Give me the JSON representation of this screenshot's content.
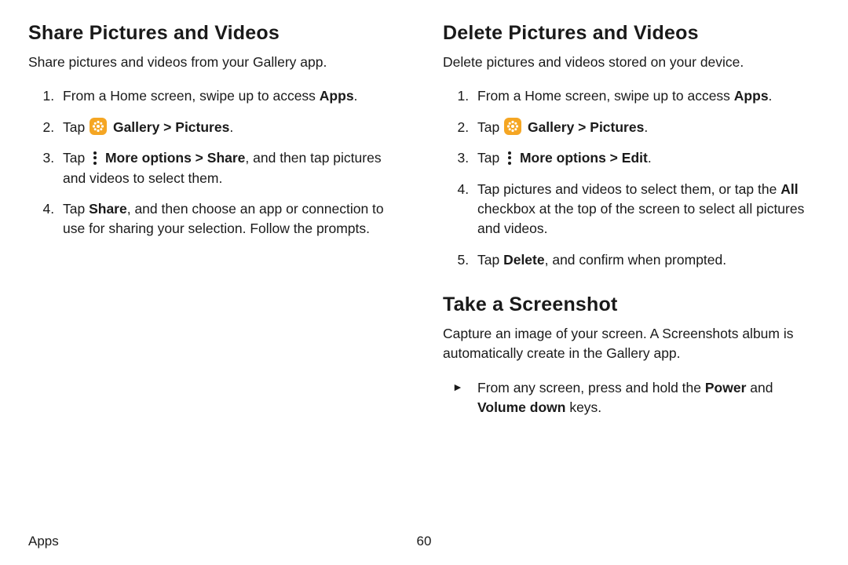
{
  "footer": {
    "section": "Apps",
    "page": "60"
  },
  "left": {
    "share": {
      "title": "Share Pictures and Videos",
      "intro": "Share pictures and videos from your Gallery app.",
      "step1_pre": "From a Home screen, swipe up to access ",
      "step1_bold": "Apps",
      "step1_post": ".",
      "step2_tap": "Tap ",
      "step2_gallery": "Gallery",
      "step2_gt": " > ",
      "step2_pictures": "Pictures",
      "step2_post": ".",
      "step3_tap": "Tap ",
      "step3_more": "More options",
      "step3_gt": " > ",
      "step3_share": "Share",
      "step3_post": ", and then tap pictures and videos to select them.",
      "step4_pre": "Tap ",
      "step4_share": "Share",
      "step4_post": ", and then choose an app or connection to use for sharing your selection. Follow the prompts."
    }
  },
  "right": {
    "del": {
      "title": "Delete Pictures and Videos",
      "intro": "Delete pictures and videos stored on your device.",
      "step1_pre": "From a Home screen, swipe up to access ",
      "step1_bold": "Apps",
      "step1_post": ".",
      "step2_tap": "Tap ",
      "step2_gallery": "Gallery",
      "step2_gt": " > ",
      "step2_pictures": "Pictures",
      "step2_post": ".",
      "step3_tap": "Tap ",
      "step3_more": "More options",
      "step3_gt": " > ",
      "step3_edit": "Edit",
      "step3_post": ".",
      "step4_pre": "Tap pictures and videos to select them, or tap the ",
      "step4_all": "All",
      "step4_post": " checkbox at the top of the screen to select all pictures and videos.",
      "step5_pre": "Tap ",
      "step5_del": "Delete",
      "step5_post": ", and confirm when prompted."
    },
    "shot": {
      "title": "Take a Screenshot",
      "intro": "Capture an image of your screen. A Screenshots album is automatically create in the Gallery app.",
      "b_pre": "From any screen, press and hold the ",
      "b_power": "Power",
      "b_and": " and ",
      "b_vol": "Volume down",
      "b_post": " keys."
    }
  }
}
